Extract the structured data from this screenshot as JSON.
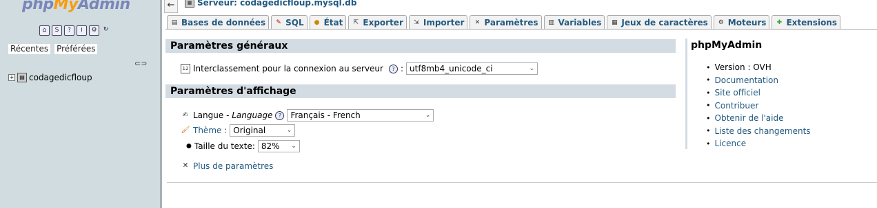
{
  "nav": {
    "logo_php": "php",
    "logo_my": "My",
    "logo_admin": "Admin",
    "icons": [
      "home-icon",
      "sql-query-icon",
      "docs-icon",
      "help-icon",
      "settings-icon",
      "reload-icon"
    ],
    "tabs": [
      {
        "label": "Récentes"
      },
      {
        "label": "Préférées"
      }
    ],
    "tree": [
      {
        "label": "codagedicfloup"
      }
    ]
  },
  "breadcrumb": {
    "label": "Serveur: codagedicfloup.mysql.db"
  },
  "tabs": [
    {
      "label": "Bases de données",
      "icon": "database-icon"
    },
    {
      "label": "SQL",
      "icon": "sql-icon"
    },
    {
      "label": "État",
      "icon": "status-icon"
    },
    {
      "label": "Exporter",
      "icon": "export-icon"
    },
    {
      "label": "Importer",
      "icon": "import-icon"
    },
    {
      "label": "Paramètres",
      "icon": "settings-icon"
    },
    {
      "label": "Variables",
      "icon": "variables-icon"
    },
    {
      "label": "Jeux de caractères",
      "icon": "charset-icon"
    },
    {
      "label": "Moteurs",
      "icon": "engines-icon"
    },
    {
      "label": "Extensions",
      "icon": "extensions-icon"
    }
  ],
  "general": {
    "title": "Paramètres généraux",
    "collation_label": "Interclassement pour la connexion au serveur",
    "collation_value": "utf8mb4_unicode_ci"
  },
  "display": {
    "title": "Paramètres d'affichage",
    "language_label": "Langue - ",
    "language_label_italic": "Language",
    "language_value": "Français - French",
    "theme_label": "Thème :",
    "theme_value": "Original",
    "fontsize_label": "Taille du texte:",
    "fontsize_value": "82%",
    "more_settings": "Plus de paramètres"
  },
  "pma": {
    "title": "phpMyAdmin",
    "version": "Version : OVH",
    "links": [
      "Documentation",
      "Site officiel",
      "Contribuer",
      "Obtenir de l'aide",
      "Liste des changements",
      "Licence"
    ]
  },
  "colors": {
    "nav_bg": "#d0dce0",
    "link": "#235a81",
    "section_bg": "#d3dce3"
  }
}
